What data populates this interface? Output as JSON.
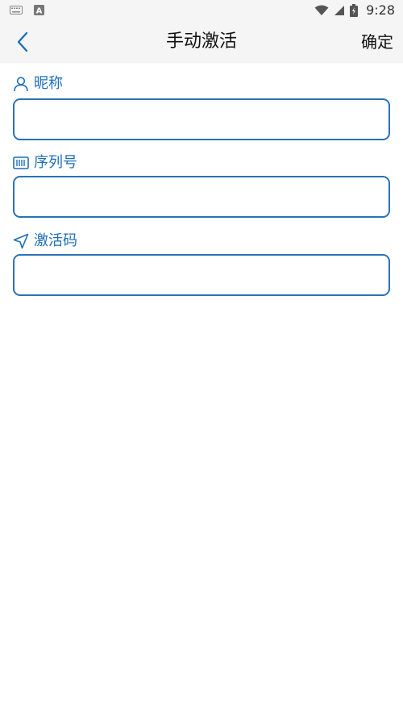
{
  "status_bar": {
    "time": "9:28",
    "left_icons": [
      "keyboard-icon",
      "a-notification-icon"
    ],
    "right_icons": [
      "wifi-icon",
      "signal-icon",
      "battery-icon"
    ]
  },
  "app_bar": {
    "title": "手动激活",
    "confirm_label": "确定",
    "back_icon": "chevron-left-icon"
  },
  "form": {
    "fields": [
      {
        "label": "昵称",
        "icon": "user-icon",
        "value": ""
      },
      {
        "label": "序列号",
        "icon": "barcode-icon",
        "value": ""
      },
      {
        "label": "激活码",
        "icon": "send-icon",
        "value": ""
      }
    ]
  },
  "colors": {
    "accent": "#1f6fb8",
    "input_border": "#2a72b5",
    "bar_background": "#f5f5f5"
  }
}
